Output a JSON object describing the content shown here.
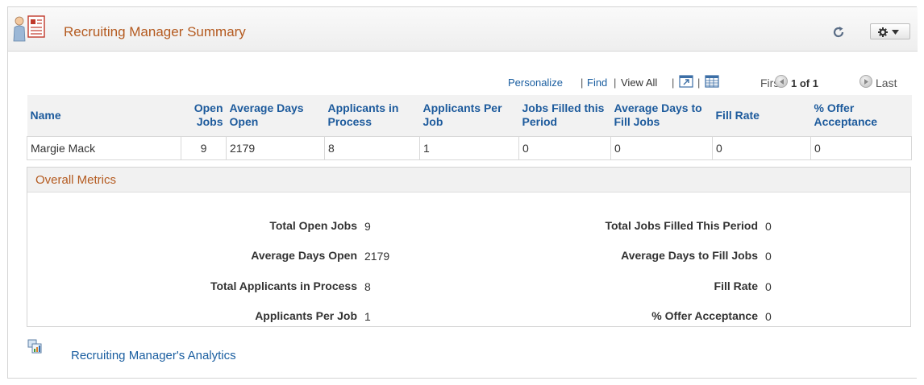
{
  "pagelet": {
    "title": "Recruiting Manager Summary"
  },
  "toolbar": {
    "personalize": "Personalize",
    "find": "Find",
    "view_all": "View All",
    "separator": "|",
    "first": "First",
    "page_count": "1 of 1",
    "last": "Last"
  },
  "grid": {
    "columns": [
      {
        "label": "Name"
      },
      {
        "label": "Open Jobs"
      },
      {
        "label": "Average Days Open"
      },
      {
        "label": "Applicants in Process"
      },
      {
        "label": "Applicants Per Job"
      },
      {
        "label": "Jobs Filled this Period"
      },
      {
        "label": "Average Days to Fill Jobs"
      },
      {
        "label": "Fill Rate"
      },
      {
        "label": "% Offer Acceptance"
      }
    ],
    "rows": [
      [
        "Margie Mack",
        "9",
        "2179",
        "8",
        "1",
        "0",
        "0",
        "0",
        "0"
      ]
    ]
  },
  "metrics": {
    "title": "Overall Metrics",
    "left": [
      {
        "label": "Total Open Jobs",
        "value": "9"
      },
      {
        "label": "Average Days Open",
        "value": "2179"
      },
      {
        "label": "Total Applicants in Process",
        "value": "8"
      },
      {
        "label": "Applicants Per Job",
        "value": "1"
      }
    ],
    "right": [
      {
        "label": "Total Jobs Filled This Period",
        "value": "0"
      },
      {
        "label": "Average Days to Fill Jobs",
        "value": "0"
      },
      {
        "label": "Fill Rate",
        "value": "0"
      },
      {
        "label": "% Offer Acceptance",
        "value": "0"
      }
    ]
  },
  "analytics_link": "Recruiting Manager's Analytics",
  "colors": {
    "title_orange": "#b45a1f",
    "link_blue": "#1a5ea0",
    "header_blue": "#1c5a9c"
  },
  "icons": {
    "header": "person-document-icon",
    "refresh": "refresh-icon",
    "options": "gear-icon",
    "zoom": "zoom-grid-icon",
    "download": "download-spreadsheet-icon",
    "analytics": "analytics-icon"
  }
}
